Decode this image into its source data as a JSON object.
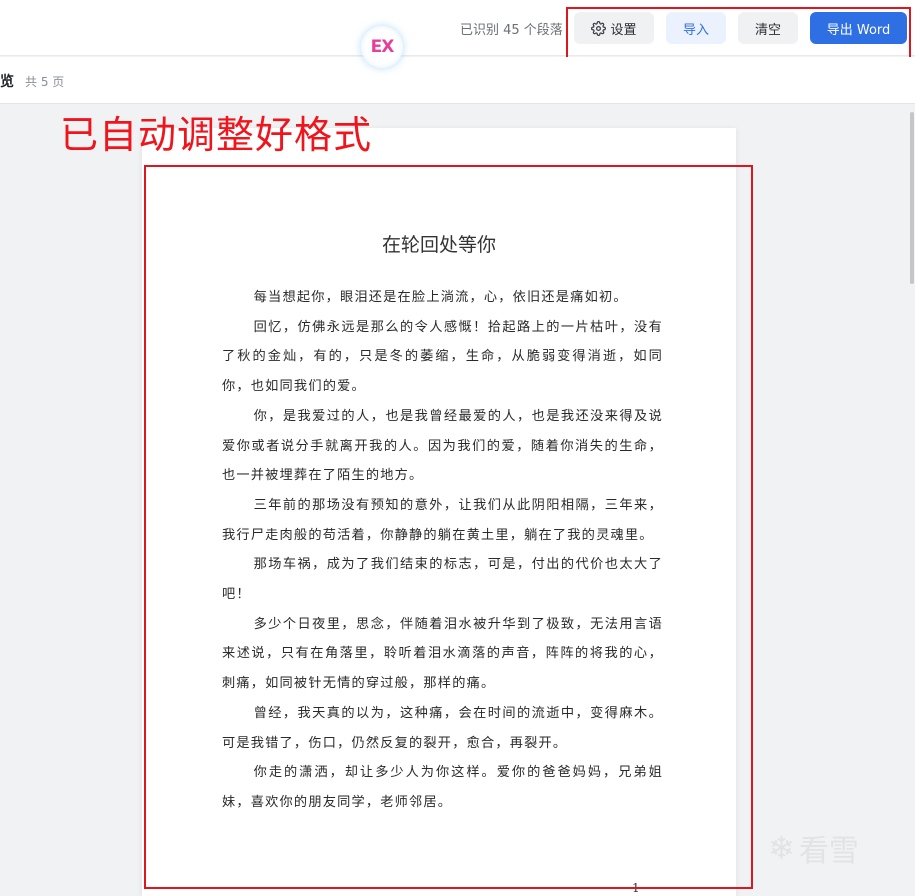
{
  "toolbar": {
    "logo_text": "EX",
    "status": "已识别 45 个段落",
    "settings_label": "设置",
    "import_label": "导入",
    "clear_label": "清空",
    "export_label": "导出 Word"
  },
  "subbar": {
    "title": "览",
    "pages": "共 5 页"
  },
  "annotation": "已自动调整好格式",
  "document": {
    "title": "在轮回处等你",
    "paragraphs": [
      "每当想起你，眼泪还是在脸上淌流，心，依旧还是痛如初。",
      "回忆，仿佛永远是那么的令人感慨！拾起路上的一片枯叶，没有了秋的金灿，有的，只是冬的萎缩，生命，从脆弱变得消逝，如同你，也如同我们的爱。",
      "你，是我爱过的人，也是我曾经最爱的人，也是我还没来得及说爱你或者说分手就离开我的人。因为我们的爱，随着你消失的生命，也一并被埋葬在了陌生的地方。",
      "三年前的那场没有预知的意外，让我们从此阴阳相隔，三年来，我行尸走肉般的苟活着，你静静的躺在黄土里，躺在了我的灵魂里。",
      "那场车祸，成为了我们结束的标志，可是，付出的代价也太大了吧！",
      "多少个日夜里，思念，伴随着泪水被升华到了极致，无法用言语来述说，只有在角落里，聆听着泪水滴落的声音，阵阵的将我的心，刺痛，如同被针无情的穿过般，那样的痛。",
      "曾经，我天真的以为，这种痛，会在时间的流逝中，变得麻木。可是我错了，伤口，仍然反复的裂开，愈合，再裂开。",
      "你走的潇洒，却让多少人为你这样。爱你的爸爸妈妈，兄弟姐妹，喜欢你的朋友同学，老师邻居。"
    ],
    "page_number": "—1—"
  },
  "watermark": {
    "icon": "snowflake-icon",
    "text": "看雪"
  },
  "colors": {
    "accent": "#2f6fe4",
    "annotation_red": "#f0141c"
  }
}
